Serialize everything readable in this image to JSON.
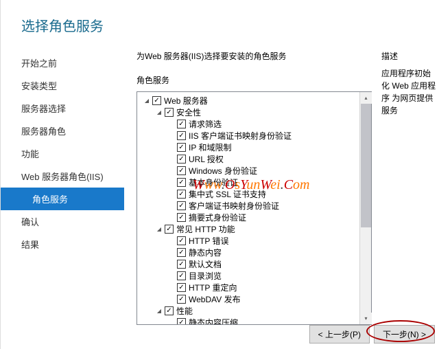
{
  "header": {
    "title": "选择角色服务"
  },
  "sidebar": {
    "items": [
      {
        "label": "开始之前"
      },
      {
        "label": "安装类型"
      },
      {
        "label": "服务器选择"
      },
      {
        "label": "服务器角色"
      },
      {
        "label": "功能"
      },
      {
        "label": "Web 服务器角色(IIS)"
      },
      {
        "label": "角色服务",
        "sub": true,
        "active": true
      },
      {
        "label": "确认"
      },
      {
        "label": "结果"
      }
    ]
  },
  "main": {
    "subtitle": "为Web 服务器(IIS)选择要安装的角色服务",
    "section_label": "角色服务",
    "tree": [
      {
        "indent": 0,
        "expander": "open",
        "checked": true,
        "label": "Web 服务器"
      },
      {
        "indent": 1,
        "expander": "open",
        "checked": true,
        "label": "安全性"
      },
      {
        "indent": 2,
        "expander": "empty",
        "checked": true,
        "label": "请求筛选"
      },
      {
        "indent": 2,
        "expander": "empty",
        "checked": true,
        "label": "IIS 客户端证书映射身份验证"
      },
      {
        "indent": 2,
        "expander": "empty",
        "checked": true,
        "label": "IP 和域限制"
      },
      {
        "indent": 2,
        "expander": "empty",
        "checked": true,
        "label": "URL 授权"
      },
      {
        "indent": 2,
        "expander": "empty",
        "checked": true,
        "label": "Windows 身份验证"
      },
      {
        "indent": 2,
        "expander": "empty",
        "checked": true,
        "label": "基本身份验证"
      },
      {
        "indent": 2,
        "expander": "empty",
        "checked": true,
        "label": "集中式 SSL 证书支持"
      },
      {
        "indent": 2,
        "expander": "empty",
        "checked": true,
        "label": "客户端证书映射身份验证"
      },
      {
        "indent": 2,
        "expander": "empty",
        "checked": true,
        "label": "摘要式身份验证"
      },
      {
        "indent": 1,
        "expander": "open",
        "checked": true,
        "label": "常见 HTTP 功能"
      },
      {
        "indent": 2,
        "expander": "empty",
        "checked": true,
        "label": "HTTP 错误"
      },
      {
        "indent": 2,
        "expander": "empty",
        "checked": true,
        "label": "静态内容"
      },
      {
        "indent": 2,
        "expander": "empty",
        "checked": true,
        "label": "默认文档"
      },
      {
        "indent": 2,
        "expander": "empty",
        "checked": true,
        "label": "目录浏览"
      },
      {
        "indent": 2,
        "expander": "empty",
        "checked": true,
        "label": "HTTP 重定向"
      },
      {
        "indent": 2,
        "expander": "empty",
        "checked": true,
        "label": "WebDAV 发布"
      },
      {
        "indent": 1,
        "expander": "open",
        "checked": true,
        "label": "性能"
      },
      {
        "indent": 2,
        "expander": "empty",
        "checked": true,
        "label": "静态内容压缩"
      }
    ]
  },
  "desc": {
    "title": "描述",
    "text": "应用程序初始化 Web 应用程序 为网页提供服务"
  },
  "footer": {
    "prev": "< 上一步(P)",
    "next": "下一步(N) >"
  },
  "watermark": "Www.OsYunWei.Com"
}
